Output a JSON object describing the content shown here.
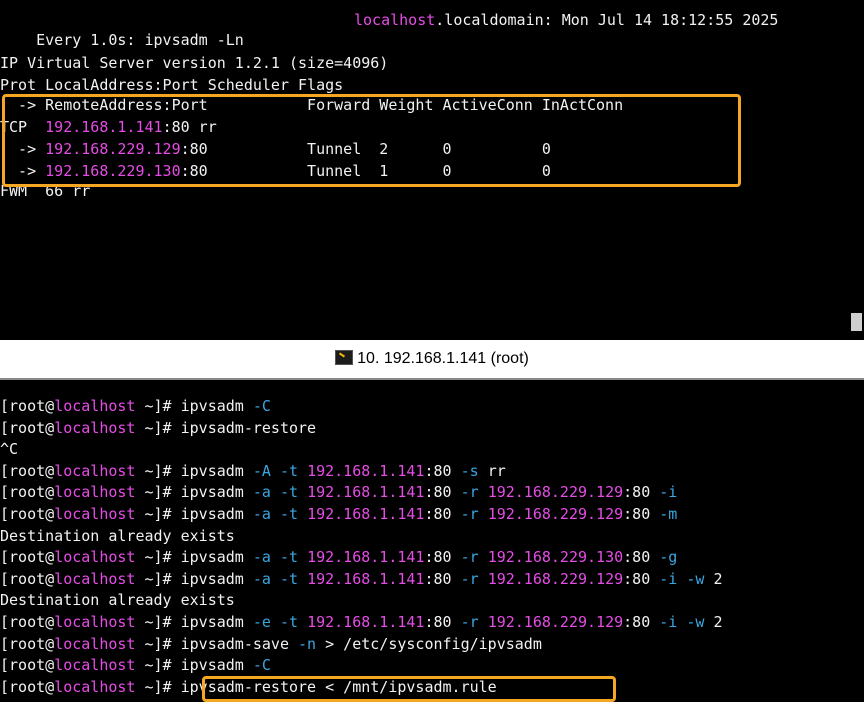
{
  "watch_pane": {
    "header": {
      "command": "Every 1.0s: ipvsadm -Ln",
      "host_prefix": "localhost",
      "host_suffix": ".localdomain: Mon Jul 14 18:12:55 2025"
    },
    "version_line": "IP Virtual Server version 1.2.1 (size=4096)",
    "columns_line": "Prot LocalAddress:Port Scheduler Flags",
    "remote_header": "  -> RemoteAddress:Port           Forward Weight ActiveConn InActConn",
    "service": {
      "proto": "TCP  ",
      "address": "192.168.1.141",
      "rest": ":80 rr"
    },
    "real_servers": [
      {
        "prefix": "  -> ",
        "ip": "192.168.229.129",
        "rest": ":80           Tunnel  2      0          0"
      },
      {
        "prefix": "  -> ",
        "ip": "192.168.229.130",
        "rest": ":80           Tunnel  1      0          0"
      }
    ],
    "fwm_line": "FWM  66 rr"
  },
  "session_tab": {
    "title": "10. 192.168.1.141 (root)",
    "icon": "terminal-icon"
  },
  "shell": {
    "prompt_user": "[root@",
    "prompt_host": "localhost",
    "prompt_tail": " ~]# ",
    "lines": [
      {
        "type": "cmd",
        "parts": [
          {
            "t": "ipvsadm ",
            "c": "white"
          },
          {
            "t": "-C",
            "c": "cyan"
          }
        ]
      },
      {
        "type": "cmd",
        "parts": [
          {
            "t": "ipvsadm-restore",
            "c": "white"
          }
        ]
      },
      {
        "type": "out",
        "text": "^C"
      },
      {
        "type": "cmd",
        "parts": [
          {
            "t": "ipvsadm ",
            "c": "white"
          },
          {
            "t": "-A -t ",
            "c": "cyan"
          },
          {
            "t": "192.168.1.141",
            "c": "magenta"
          },
          {
            "t": ":80 ",
            "c": "white"
          },
          {
            "t": "-s ",
            "c": "cyan"
          },
          {
            "t": "rr",
            "c": "white"
          }
        ]
      },
      {
        "type": "cmd",
        "parts": [
          {
            "t": "ipvsadm ",
            "c": "white"
          },
          {
            "t": "-a -t ",
            "c": "cyan"
          },
          {
            "t": "192.168.1.141",
            "c": "magenta"
          },
          {
            "t": ":80 ",
            "c": "white"
          },
          {
            "t": "-r ",
            "c": "cyan"
          },
          {
            "t": "192.168.229.129",
            "c": "magenta"
          },
          {
            "t": ":80 ",
            "c": "white"
          },
          {
            "t": "-i",
            "c": "cyan"
          }
        ]
      },
      {
        "type": "cmd",
        "parts": [
          {
            "t": "ipvsadm ",
            "c": "white"
          },
          {
            "t": "-a -t ",
            "c": "cyan"
          },
          {
            "t": "192.168.1.141",
            "c": "magenta"
          },
          {
            "t": ":80 ",
            "c": "white"
          },
          {
            "t": "-r ",
            "c": "cyan"
          },
          {
            "t": "192.168.229.129",
            "c": "magenta"
          },
          {
            "t": ":80 ",
            "c": "white"
          },
          {
            "t": "-m",
            "c": "cyan"
          }
        ]
      },
      {
        "type": "out",
        "text": "Destination already exists"
      },
      {
        "type": "cmd",
        "parts": [
          {
            "t": "ipvsadm ",
            "c": "white"
          },
          {
            "t": "-a -t ",
            "c": "cyan"
          },
          {
            "t": "192.168.1.141",
            "c": "magenta"
          },
          {
            "t": ":80 ",
            "c": "white"
          },
          {
            "t": "-r ",
            "c": "cyan"
          },
          {
            "t": "192.168.229.130",
            "c": "magenta"
          },
          {
            "t": ":80 ",
            "c": "white"
          },
          {
            "t": "-g",
            "c": "cyan"
          }
        ]
      },
      {
        "type": "cmd",
        "parts": [
          {
            "t": "ipvsadm ",
            "c": "white"
          },
          {
            "t": "-a -t ",
            "c": "cyan"
          },
          {
            "t": "192.168.1.141",
            "c": "magenta"
          },
          {
            "t": ":80 ",
            "c": "white"
          },
          {
            "t": "-r ",
            "c": "cyan"
          },
          {
            "t": "192.168.229.129",
            "c": "magenta"
          },
          {
            "t": ":80 ",
            "c": "white"
          },
          {
            "t": "-i -w ",
            "c": "cyan"
          },
          {
            "t": "2",
            "c": "white"
          }
        ]
      },
      {
        "type": "out",
        "text": "Destination already exists"
      },
      {
        "type": "cmd",
        "parts": [
          {
            "t": "ipvsadm ",
            "c": "white"
          },
          {
            "t": "-e -t ",
            "c": "cyan"
          },
          {
            "t": "192.168.1.141",
            "c": "magenta"
          },
          {
            "t": ":80 ",
            "c": "white"
          },
          {
            "t": "-r ",
            "c": "cyan"
          },
          {
            "t": "192.168.229.129",
            "c": "magenta"
          },
          {
            "t": ":80 ",
            "c": "white"
          },
          {
            "t": "-i -w ",
            "c": "cyan"
          },
          {
            "t": "2",
            "c": "white"
          }
        ]
      },
      {
        "type": "cmd",
        "parts": [
          {
            "t": "ipvsadm-save ",
            "c": "white"
          },
          {
            "t": "-n",
            "c": "cyan"
          },
          {
            "t": " > /etc/sysconfig/ipvsadm",
            "c": "white"
          }
        ]
      },
      {
        "type": "cmd",
        "parts": [
          {
            "t": "ipvsadm ",
            "c": "white"
          },
          {
            "t": "-C",
            "c": "cyan"
          }
        ]
      },
      {
        "type": "cmd",
        "parts": [
          {
            "t": "ipvsadm-restore < /mnt/ipvsadm.rule",
            "c": "white"
          }
        ]
      }
    ]
  },
  "colors": {
    "terminal_bg": "#000000",
    "text": "#f2f2f2",
    "option": "#3aa6e0",
    "address": "#e64ce6",
    "highlight": "#f5a623"
  }
}
